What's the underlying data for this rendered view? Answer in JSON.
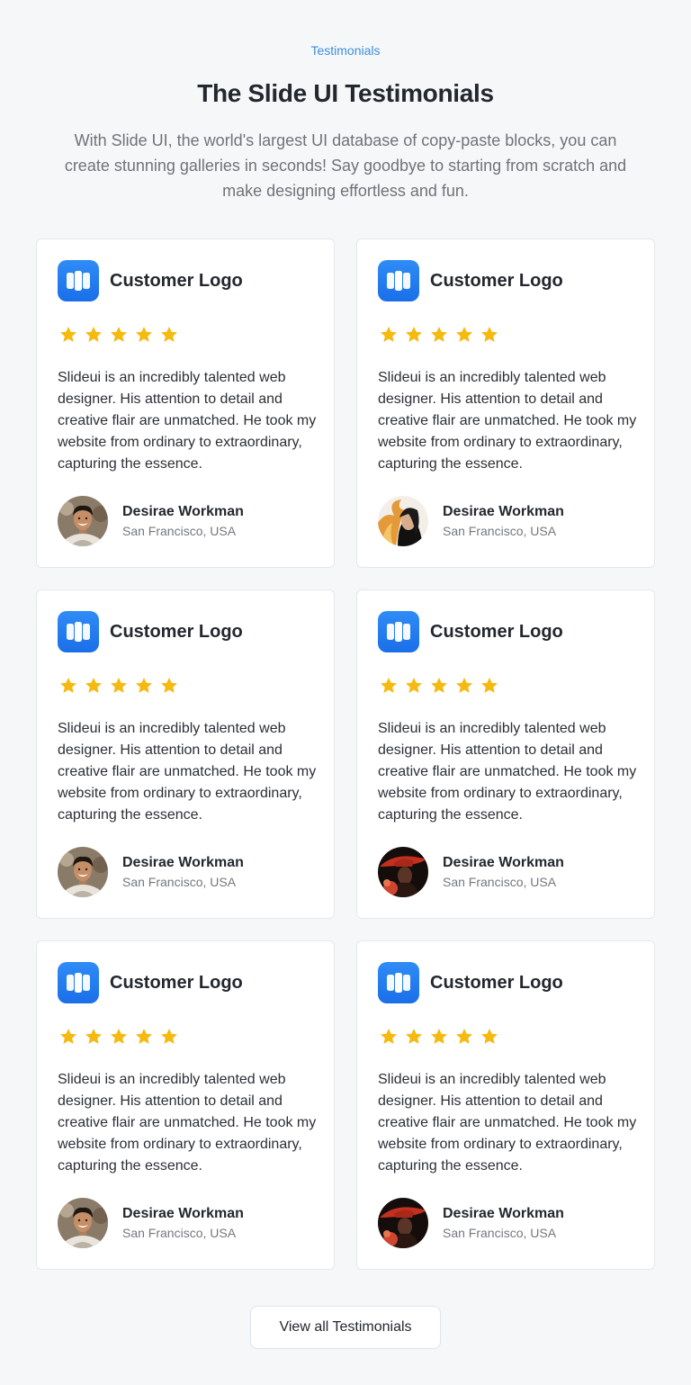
{
  "header": {
    "eyebrow": "Testimonials",
    "title": "The Slide UI Testimonials",
    "subtitle": "With Slide UI, the world's largest UI database of copy-paste blocks, you can create stunning galleries in seconds! Say goodbye to starting from scratch and make designing effortless and fun."
  },
  "colors": {
    "accent": "#3d8fe0",
    "logo": "#1a6fe8",
    "star": "#f5b90f"
  },
  "testimonials": [
    {
      "logo_icon": "app-logo-icon",
      "company": "Customer Logo",
      "rating": 5,
      "quote": "Slideui is an incredibly talented web designer. His attention to detail and creative flair are unmatched. He took my website from ordinary to extraordinary, capturing the essence.",
      "name": "Desirae Workman",
      "location": "San Francisco, USA",
      "avatar": "avatar-man-smiling"
    },
    {
      "logo_icon": "app-logo-icon",
      "company": "Customer Logo",
      "rating": 5,
      "quote": "Slideui is an incredibly talented web designer. His attention to detail and creative flair are unmatched. He took my website from ordinary to extraordinary, capturing the essence.",
      "name": "Desirae Workman",
      "location": "San Francisco, USA",
      "avatar": "avatar-woman-fire"
    },
    {
      "logo_icon": "app-logo-icon",
      "company": "Customer Logo",
      "rating": 5,
      "quote": "Slideui is an incredibly talented web designer. His attention to detail and creative flair are unmatched. He took my website from ordinary to extraordinary, capturing the essence.",
      "name": "Desirae Workman",
      "location": "San Francisco, USA",
      "avatar": "avatar-man-smiling"
    },
    {
      "logo_icon": "app-logo-icon",
      "company": "Customer Logo",
      "rating": 5,
      "quote": "Slideui is an incredibly talented web designer. His attention to detail and creative flair are unmatched. He took my website from ordinary to extraordinary, capturing the essence.",
      "name": "Desirae Workman",
      "location": "San Francisco, USA",
      "avatar": "avatar-woman-red-hat"
    },
    {
      "logo_icon": "app-logo-icon",
      "company": "Customer Logo",
      "rating": 5,
      "quote": "Slideui is an incredibly talented web designer. His attention to detail and creative flair are unmatched. He took my website from ordinary to extraordinary, capturing the essence.",
      "name": "Desirae Workman",
      "location": "San Francisco, USA",
      "avatar": "avatar-man-smiling"
    },
    {
      "logo_icon": "app-logo-icon",
      "company": "Customer Logo",
      "rating": 5,
      "quote": "Slideui is an incredibly talented web designer. His attention to detail and creative flair are unmatched. He took my website from ordinary to extraordinary, capturing the essence.",
      "name": "Desirae Workman",
      "location": "San Francisco, USA",
      "avatar": "avatar-woman-red-hat"
    }
  ],
  "footer": {
    "view_all_label": "View all Testimonials"
  }
}
